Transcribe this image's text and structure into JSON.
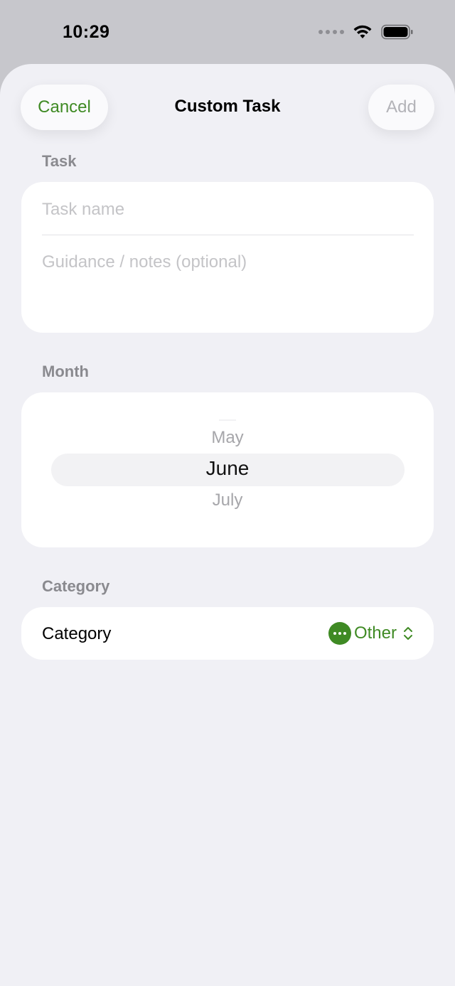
{
  "status": {
    "time": "10:29"
  },
  "nav": {
    "cancel_label": "Cancel",
    "title": "Custom Task",
    "add_label": "Add"
  },
  "task_section": {
    "label": "Task",
    "name_placeholder": "Task name",
    "notes_placeholder": "Guidance / notes (optional)"
  },
  "month_section": {
    "label": "Month",
    "previous": "May",
    "selected": "June",
    "next": "July"
  },
  "category_section": {
    "label": "Category",
    "row_label": "Category",
    "value": "Other",
    "icon": "ellipsis-circle-icon"
  },
  "colors": {
    "accent": "#3f8a24",
    "background": "#f0f0f5"
  }
}
